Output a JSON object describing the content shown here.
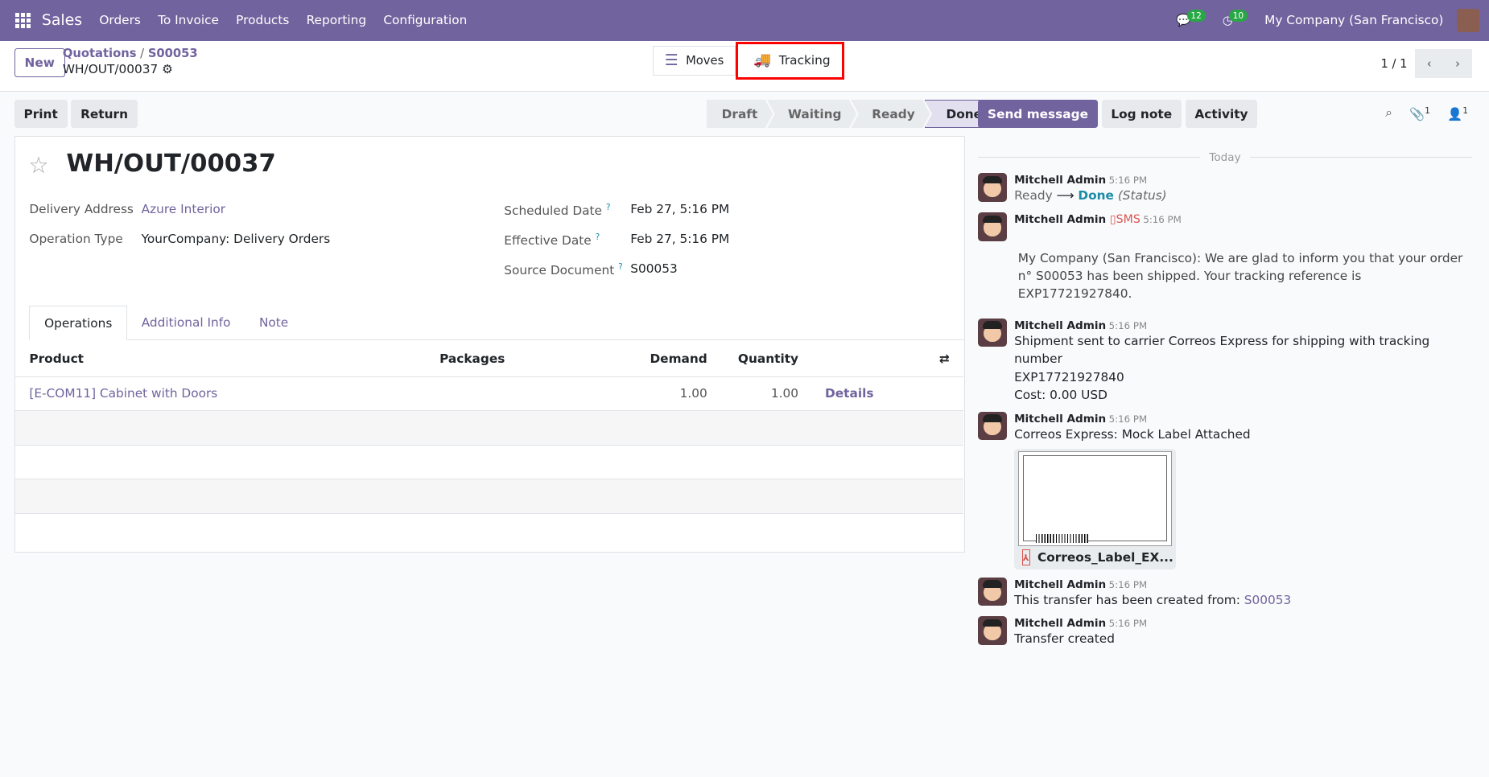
{
  "nav": {
    "app": "Sales",
    "menu": [
      "Orders",
      "To Invoice",
      "Products",
      "Reporting",
      "Configuration"
    ],
    "messages_count": "12",
    "activities_count": "10",
    "company": "My Company (San Francisco)"
  },
  "cp": {
    "new": "New",
    "breadcrumb": [
      "Quotations",
      "S00053"
    ],
    "current": "WH/OUT/00037",
    "moves": "Moves",
    "tracking": "Tracking",
    "pager": "1 / 1"
  },
  "toolbar": {
    "print": "Print",
    "return": "Return"
  },
  "statusbar": [
    "Draft",
    "Waiting",
    "Ready",
    "Done"
  ],
  "form": {
    "title": "WH/OUT/00037",
    "delivery_address_label": "Delivery Address",
    "delivery_address": "Azure Interior",
    "operation_type_label": "Operation Type",
    "operation_type": "YourCompany: Delivery Orders",
    "scheduled_date_label": "Scheduled Date",
    "scheduled_date": "Feb 27, 5:16 PM",
    "effective_date_label": "Effective Date",
    "effective_date": "Feb 27, 5:16 PM",
    "source_document_label": "Source Document",
    "source_document": "S00053",
    "help": "?",
    "tabs": [
      "Operations",
      "Additional Info",
      "Note"
    ],
    "columns": [
      "Product",
      "Packages",
      "Demand",
      "Quantity"
    ],
    "rows": [
      {
        "product": "[E-COM11] Cabinet with Doors",
        "packages": "",
        "demand": "1.00",
        "quantity": "1.00",
        "details": "Details"
      }
    ]
  },
  "chatter": {
    "send_message": "Send message",
    "log_note": "Log note",
    "activity": "Activity",
    "attachments_count": "1",
    "followers_count": "1",
    "today": "Today",
    "author": "Mitchell Admin",
    "time": "5:16 PM",
    "m1": {
      "from": "Ready",
      "to": "Done",
      "field": "(Status)"
    },
    "m2": {
      "sms": "SMS",
      "text": "My Company (San Francisco): We are glad to inform you that your order n° S00053 has been shipped. Your tracking reference is EXP17721927840."
    },
    "m3": {
      "line1": "Shipment sent to carrier Correos Express for shipping with tracking number",
      "line2": "EXP17721927840",
      "line3": "Cost: 0.00 USD"
    },
    "m4": {
      "text": "Correos Express: Mock Label Attached",
      "attachment": "Correos_Label_EX..."
    },
    "m5": {
      "text": "This transfer has been created from:",
      "link": "S00053"
    },
    "m6": {
      "text": "Transfer created"
    }
  }
}
